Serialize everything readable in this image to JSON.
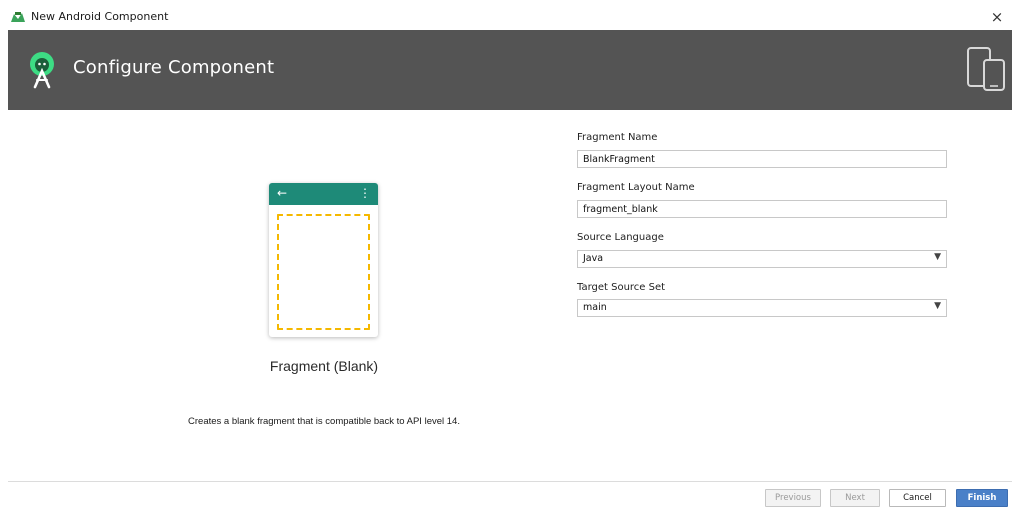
{
  "window": {
    "title": "New Android Component",
    "close_glyph": "×"
  },
  "header": {
    "title": "Configure Component",
    "logo_icon": "android-studio-icon",
    "device_icon": "devices-icon"
  },
  "preview": {
    "back_glyph": "←",
    "overflow_glyph": "⋮",
    "label": "Fragment (Blank)",
    "description": "Creates a blank fragment that is compatible back to API level 14.",
    "appbar_color": "#1e8a78",
    "placeholder_color": "#f5b800"
  },
  "form": {
    "fragment_name_label": "Fragment Name",
    "fragment_name_value": "BlankFragment",
    "layout_name_label": "Fragment Layout Name",
    "layout_name_value": "fragment_blank",
    "source_language_label": "Source Language",
    "source_language_value": "Java",
    "target_source_set_label": "Target Source Set",
    "target_source_set_value": "main"
  },
  "footer": {
    "previous_label": "Previous",
    "next_label": "Next",
    "cancel_label": "Cancel",
    "finish_label": "Finish"
  },
  "colors": {
    "header_bg": "#545454",
    "primary_button": "#4a80c8"
  }
}
